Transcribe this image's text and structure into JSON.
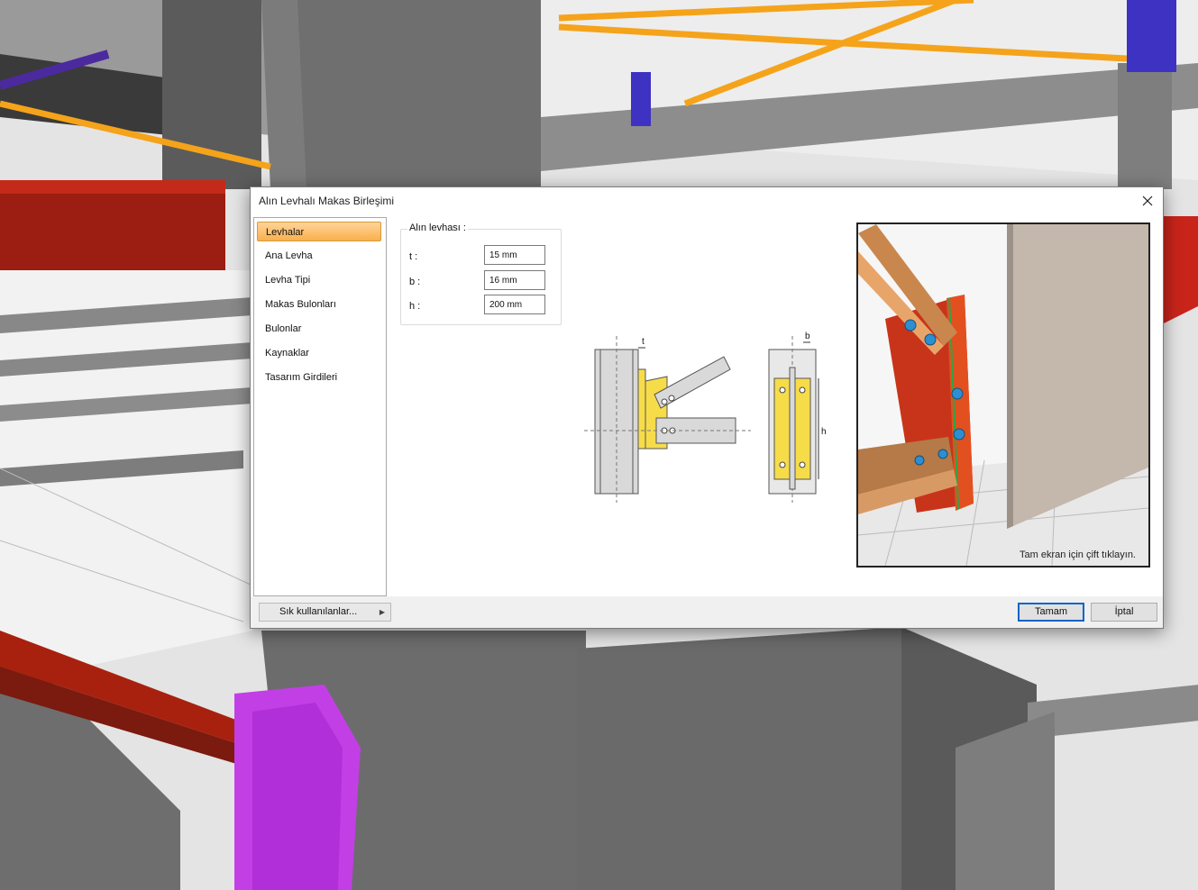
{
  "dialog": {
    "title": "Alın Levhalı Makas Birleşimi",
    "close_icon": "close-icon"
  },
  "nav": {
    "items": [
      {
        "label": "Levhalar",
        "active": true
      },
      {
        "label": "Ana Levha",
        "active": false
      },
      {
        "label": "Levha Tipi",
        "active": false
      },
      {
        "label": "Makas Bulonları",
        "active": false
      },
      {
        "label": "Bulonlar",
        "active": false
      },
      {
        "label": "Kaynaklar",
        "active": false
      },
      {
        "label": "Tasarım Girdileri",
        "active": false
      }
    ]
  },
  "plate_group": {
    "title": "Alın levhası :",
    "t": {
      "label": "t :",
      "value": "15 mm"
    },
    "b": {
      "label": "b :",
      "value": "16 mm"
    },
    "h": {
      "label": "h :",
      "value": "200 mm"
    }
  },
  "diagram": {
    "label_t": "t",
    "label_b": "b",
    "label_h": "h"
  },
  "preview": {
    "hint": "Tam ekran için çift tıklayın."
  },
  "footer": {
    "favorites_label": "Sık kullanılanlar...",
    "favorites_arrow_icon": "triangle-right-icon",
    "ok_label": "Tamam",
    "cancel_label": "İptal"
  },
  "colors": {
    "active_item": "#f9b04c",
    "default_button_border": "#0a64c8",
    "plate_yellow": "#f7dc4a",
    "plate_red": "#d63a1c"
  }
}
